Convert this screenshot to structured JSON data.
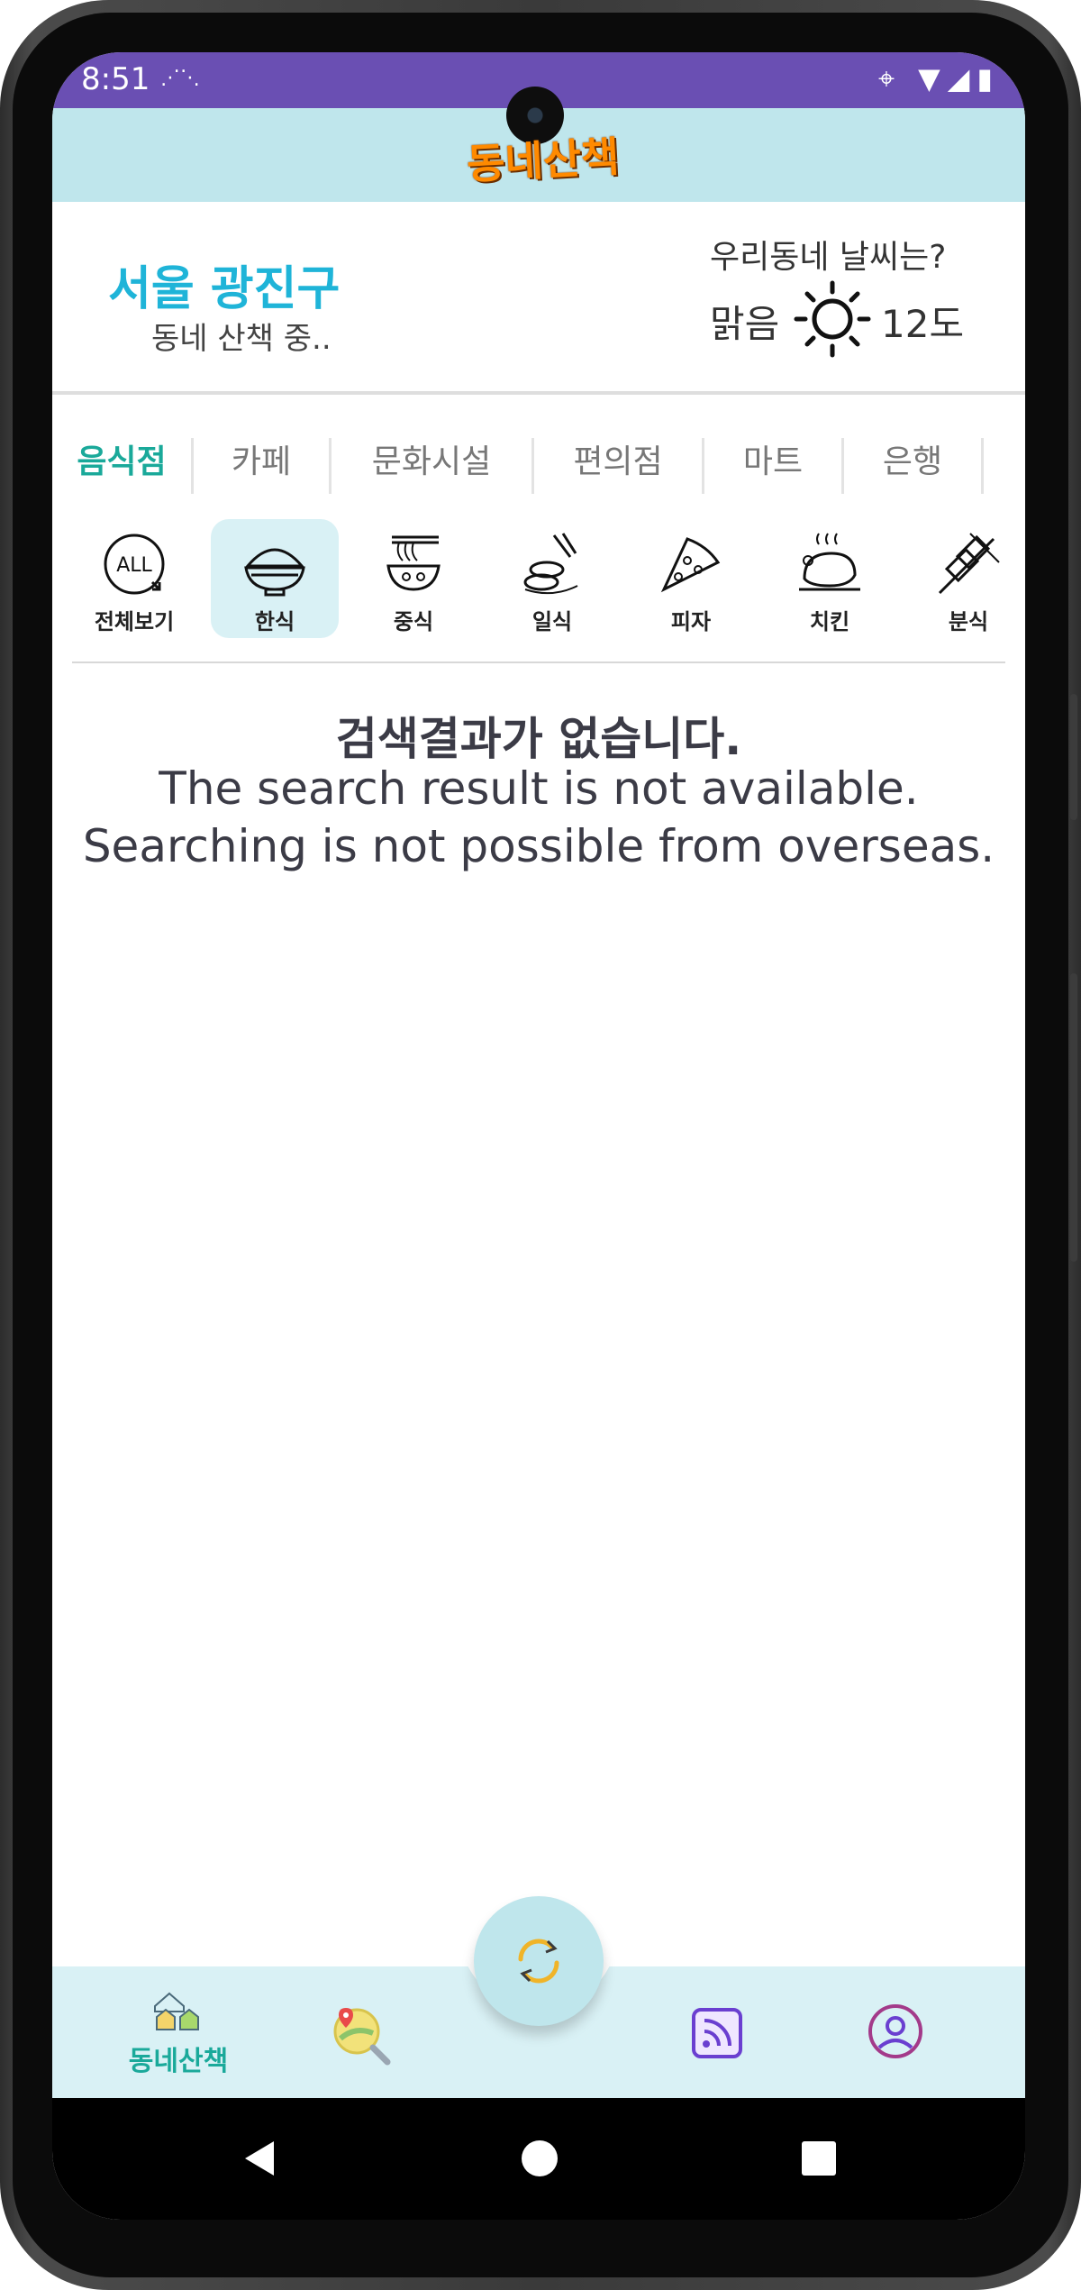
{
  "status_bar": {
    "time": "8:51"
  },
  "header": {
    "logo_text": "동네산책"
  },
  "location": {
    "region": "서울 광진구",
    "status": "동네 산책 중.."
  },
  "weather": {
    "question": "우리동네 날씨는?",
    "condition": "맑음",
    "temperature": "12도"
  },
  "category_tabs": [
    {
      "label": "음식점",
      "active": true
    },
    {
      "label": "카페",
      "active": false
    },
    {
      "label": "문화시설",
      "active": false
    },
    {
      "label": "편의점",
      "active": false
    },
    {
      "label": "마트",
      "active": false
    },
    {
      "label": "은행",
      "active": false
    }
  ],
  "food_categories": [
    {
      "label": "전체보기",
      "icon": "all-icon",
      "active": false
    },
    {
      "label": "한식",
      "icon": "rice-bowl-icon",
      "active": true
    },
    {
      "label": "중식",
      "icon": "noodle-bowl-icon",
      "active": false
    },
    {
      "label": "일식",
      "icon": "sushi-icon",
      "active": false
    },
    {
      "label": "피자",
      "icon": "pizza-icon",
      "active": false
    },
    {
      "label": "치킨",
      "icon": "chicken-icon",
      "active": false
    },
    {
      "label": "분식",
      "icon": "skewer-icon",
      "active": false
    }
  ],
  "message": {
    "korean": "검색결과가 없습니다.",
    "english1": "The search result is not available.",
    "english2": "Searching is not possible from overseas."
  },
  "bottom_nav": {
    "home_label": "동네산책",
    "items": [
      "home-icon",
      "map-search-icon",
      "refresh-icon",
      "feed-icon",
      "profile-icon"
    ]
  },
  "colors": {
    "accent": "#1aa99a",
    "region": "#1fb4d8",
    "header_bg": "#bfe6ec",
    "status_bar": "#6a4fb3",
    "nav_bg": "#d9f1f5"
  }
}
